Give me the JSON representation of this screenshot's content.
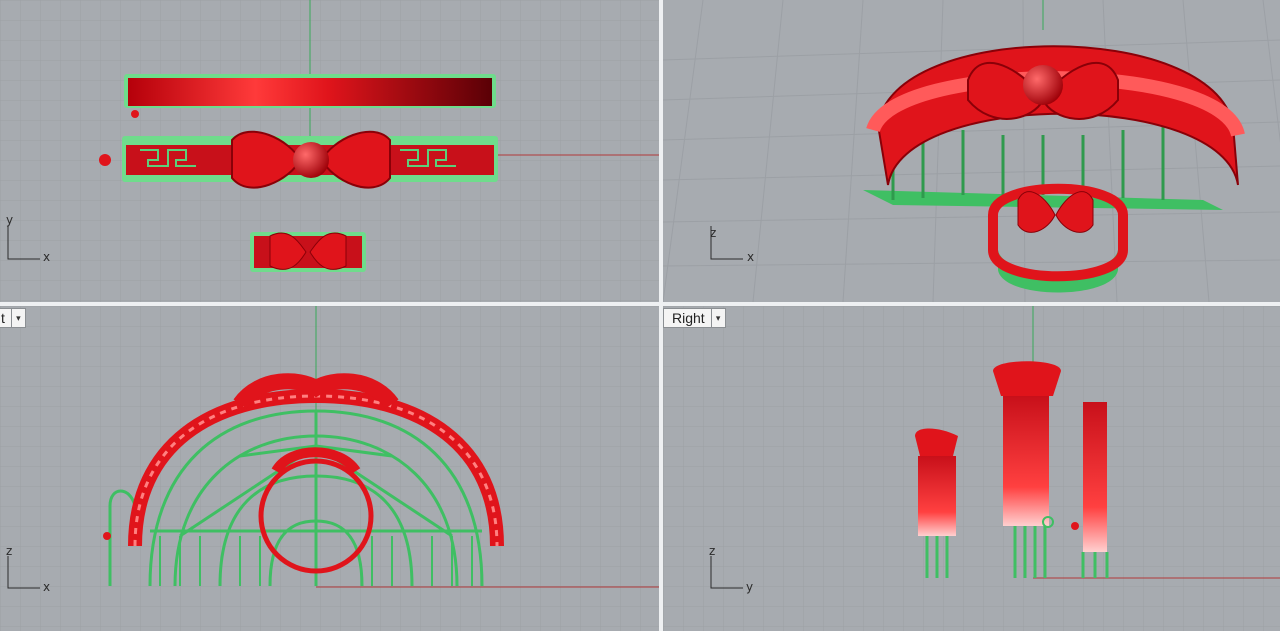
{
  "viewports": {
    "top": {
      "axes": {
        "vertical": "y",
        "horizontal": "x"
      }
    },
    "perspective": {
      "axes": {
        "vertical": "z",
        "horizontal": "x"
      }
    },
    "front": {
      "tab_label": "t",
      "axes": {
        "vertical": "z",
        "horizontal": "x"
      }
    },
    "right": {
      "tab_label": "Right",
      "axes": {
        "vertical": "z",
        "horizontal": "y"
      }
    }
  },
  "colors": {
    "viewport_bg": "#a7abb0",
    "grid_line": "#9a9ea3",
    "model_red": "#e0141b",
    "support_green": "#3fbf63",
    "world_x_axis": "#b13a3a",
    "world_y_axis": "#3aa95a"
  },
  "icons": {
    "dropdown": "chevron-down-icon"
  }
}
